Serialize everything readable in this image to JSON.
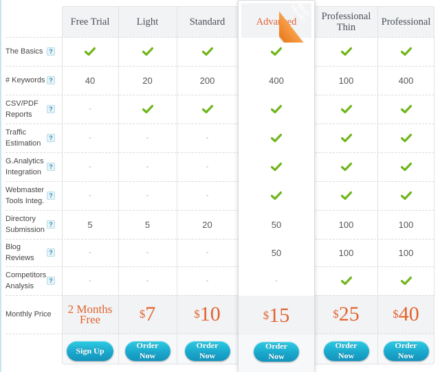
{
  "plans": [
    {
      "name": "Free Trial",
      "price_text": "2 Months Free",
      "price_line1": "2 Months",
      "price_line2": "Free",
      "button": "Sign Up"
    },
    {
      "name": "Light",
      "currency": "$",
      "price": "7",
      "button": "Order Now"
    },
    {
      "name": "Standard",
      "currency": "$",
      "price": "10",
      "button": "Order Now"
    },
    {
      "name": "Advanced",
      "currency": "$",
      "price": "15",
      "button": "Order Now",
      "featured": true,
      "badge": "BEST VALUE !"
    },
    {
      "name": "Professional Thin",
      "name_line1": "Professional",
      "name_line2": "Thin",
      "currency": "$",
      "price": "25",
      "button": "Order Now"
    },
    {
      "name": "Professional",
      "currency": "$",
      "price": "40",
      "button": "Order Now"
    }
  ],
  "badge": {
    "line1": "BEST",
    "line2": "VALUE !"
  },
  "help_icon_label": "?",
  "dash": "-",
  "rows": [
    {
      "label": "The Basics",
      "values": [
        "check",
        "check",
        "check",
        "check",
        "check",
        "check"
      ]
    },
    {
      "label": "# Keywords",
      "values": [
        "40",
        "20",
        "200",
        "400",
        "100",
        "400"
      ]
    },
    {
      "label": "CSV/PDF Reports",
      "values": [
        "-",
        "check",
        "check",
        "check",
        "check",
        "check"
      ]
    },
    {
      "label": "Traffic Estimation",
      "values": [
        "-",
        "-",
        "-",
        "check",
        "check",
        "check"
      ]
    },
    {
      "label": "G.Analytics Integration",
      "values": [
        "-",
        "-",
        "-",
        "check",
        "check",
        "check"
      ]
    },
    {
      "label": "Webmaster Tools Integ.",
      "values": [
        "-",
        "-",
        "-",
        "check",
        "check",
        "check"
      ]
    },
    {
      "label": "Directory Submission",
      "values": [
        "5",
        "5",
        "20",
        "50",
        "100",
        "100"
      ]
    },
    {
      "label": "Blog Reviews",
      "values": [
        "-",
        "-",
        "-",
        "50",
        "100",
        "100"
      ]
    },
    {
      "label": "Competitors Analysis",
      "values": [
        "-",
        "-",
        "-",
        "-",
        "check",
        "check"
      ]
    }
  ],
  "price_row_label": "Monthly Price",
  "colors": {
    "accent": "#e2632f",
    "check": "#6fb51b",
    "button": "#1aa8cc",
    "ribbon": "#ec7b1c"
  }
}
